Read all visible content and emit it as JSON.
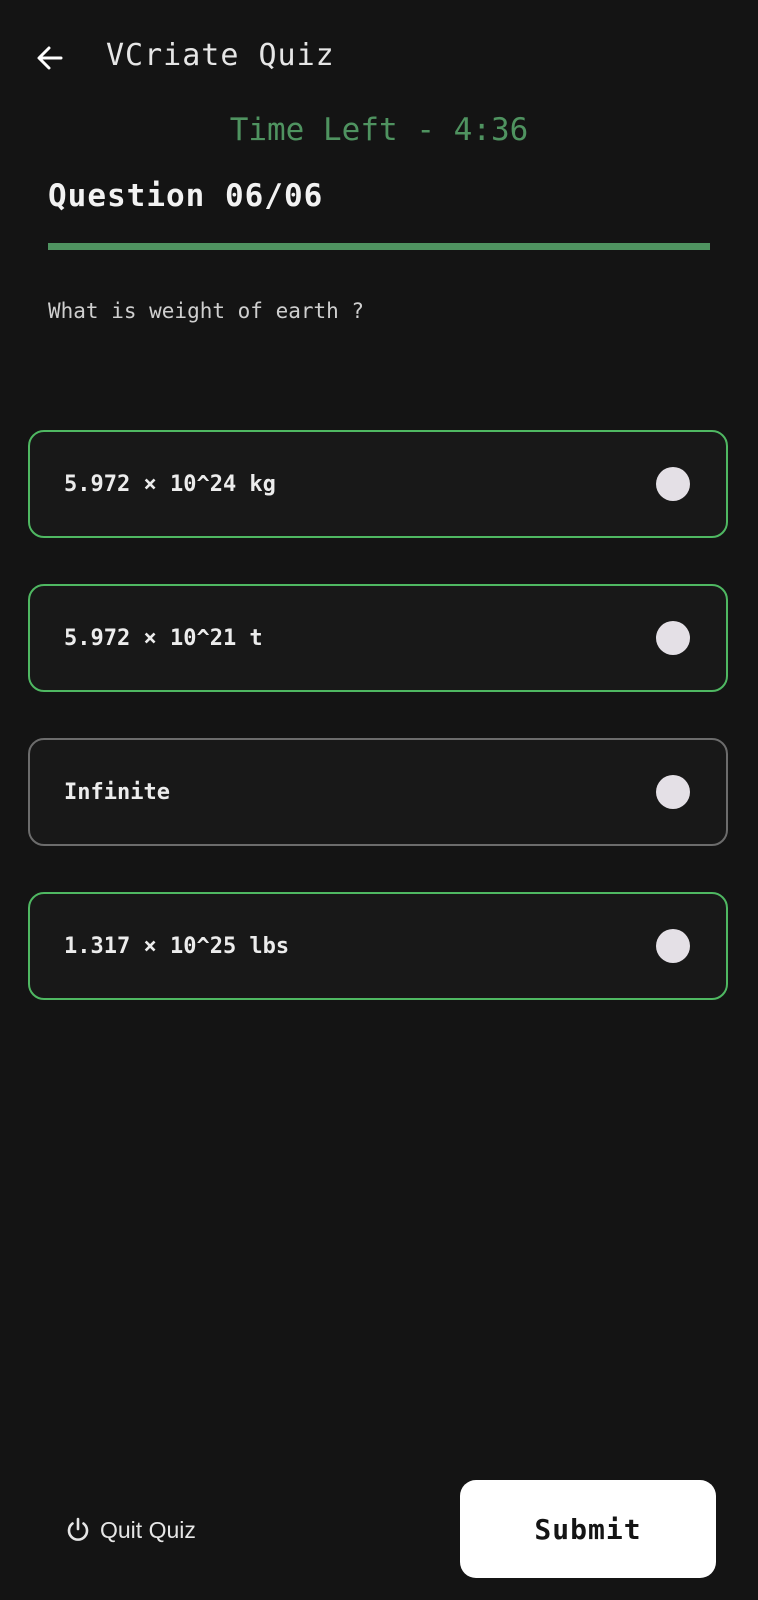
{
  "header": {
    "title": "VCriate Quiz",
    "back_icon": "arrow-left-icon"
  },
  "timer": {
    "text": "Time Left - 4:36",
    "color": "#4f9360"
  },
  "question": {
    "counter": "Question 06/06",
    "progress": 1.0,
    "text": "What is weight of earth ?"
  },
  "options": [
    {
      "label": "5.972 × 10^24 kg",
      "state": "highlighted"
    },
    {
      "label": "5.972 × 10^21 t",
      "state": "highlighted"
    },
    {
      "label": "Infinite",
      "state": "neutral"
    },
    {
      "label": "1.317 × 10^25 lbs",
      "state": "highlighted"
    }
  ],
  "footer": {
    "quit_label": "Quit Quiz",
    "quit_icon": "power-icon",
    "submit_label": "Submit"
  },
  "colors": {
    "background": "#141414",
    "accent_green": "#4fb862",
    "neutral_border": "#6c6c6c",
    "radio_fill": "#e4e0e6"
  }
}
